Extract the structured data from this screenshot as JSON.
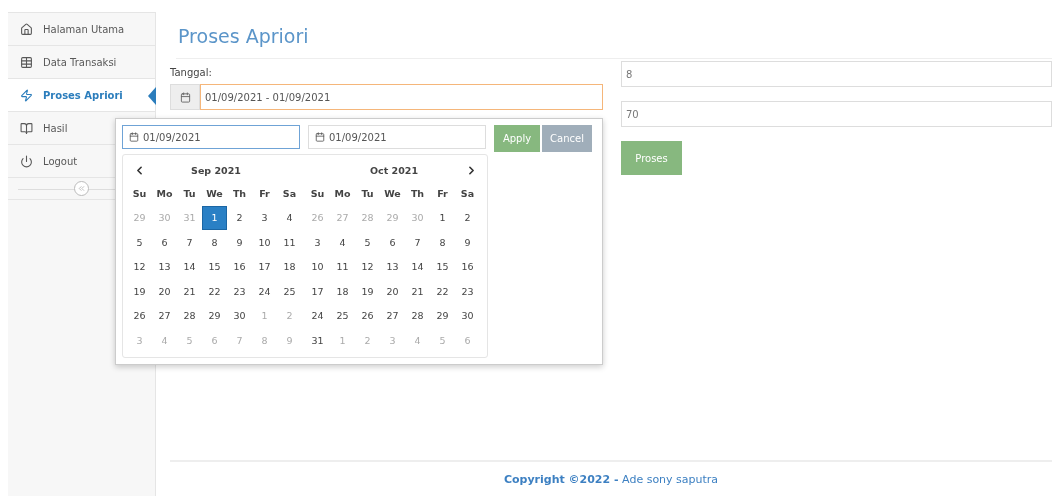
{
  "sidebar": {
    "items": [
      {
        "label": "Halaman Utama",
        "selected": false
      },
      {
        "label": "Data Transaksi",
        "selected": false
      },
      {
        "label": "Proses Apriori",
        "selected": true
      },
      {
        "label": "Hasil",
        "selected": false
      },
      {
        "label": "Logout",
        "selected": false
      }
    ]
  },
  "page": {
    "title": "Proses Apriori"
  },
  "form": {
    "date_label": "Tanggal:",
    "date_value": "01/09/2021 - 01/09/2021",
    "field_1": "8",
    "field_2": "70",
    "submit": "Proses"
  },
  "datepicker": {
    "start": "01/09/2021",
    "end": "01/09/2021",
    "apply": "Apply",
    "cancel": "Cancel",
    "months": [
      {
        "title": "Sep 2021",
        "weekdays": [
          "Su",
          "Mo",
          "Tu",
          "We",
          "Th",
          "Fr",
          "Sa"
        ],
        "weeks": [
          [
            {
              "d": "29",
              "off": true,
              "selected": false
            },
            {
              "d": "30",
              "off": true,
              "selected": false
            },
            {
              "d": "31",
              "off": true,
              "selected": false
            },
            {
              "d": "1",
              "off": false,
              "selected": true
            },
            {
              "d": "2",
              "off": false,
              "selected": false
            },
            {
              "d": "3",
              "off": false,
              "selected": false
            },
            {
              "d": "4",
              "off": false,
              "selected": false
            }
          ],
          [
            {
              "d": "5",
              "off": false,
              "selected": false
            },
            {
              "d": "6",
              "off": false,
              "selected": false
            },
            {
              "d": "7",
              "off": false,
              "selected": false
            },
            {
              "d": "8",
              "off": false,
              "selected": false
            },
            {
              "d": "9",
              "off": false,
              "selected": false
            },
            {
              "d": "10",
              "off": false,
              "selected": false
            },
            {
              "d": "11",
              "off": false,
              "selected": false
            }
          ],
          [
            {
              "d": "12",
              "off": false,
              "selected": false
            },
            {
              "d": "13",
              "off": false,
              "selected": false
            },
            {
              "d": "14",
              "off": false,
              "selected": false
            },
            {
              "d": "15",
              "off": false,
              "selected": false
            },
            {
              "d": "16",
              "off": false,
              "selected": false
            },
            {
              "d": "17",
              "off": false,
              "selected": false
            },
            {
              "d": "18",
              "off": false,
              "selected": false
            }
          ],
          [
            {
              "d": "19",
              "off": false,
              "selected": false
            },
            {
              "d": "20",
              "off": false,
              "selected": false
            },
            {
              "d": "21",
              "off": false,
              "selected": false
            },
            {
              "d": "22",
              "off": false,
              "selected": false
            },
            {
              "d": "23",
              "off": false,
              "selected": false
            },
            {
              "d": "24",
              "off": false,
              "selected": false
            },
            {
              "d": "25",
              "off": false,
              "selected": false
            }
          ],
          [
            {
              "d": "26",
              "off": false,
              "selected": false
            },
            {
              "d": "27",
              "off": false,
              "selected": false
            },
            {
              "d": "28",
              "off": false,
              "selected": false
            },
            {
              "d": "29",
              "off": false,
              "selected": false
            },
            {
              "d": "30",
              "off": false,
              "selected": false
            },
            {
              "d": "1",
              "off": true,
              "selected": false
            },
            {
              "d": "2",
              "off": true,
              "selected": false
            }
          ],
          [
            {
              "d": "3",
              "off": true,
              "selected": false
            },
            {
              "d": "4",
              "off": true,
              "selected": false
            },
            {
              "d": "5",
              "off": true,
              "selected": false
            },
            {
              "d": "6",
              "off": true,
              "selected": false
            },
            {
              "d": "7",
              "off": true,
              "selected": false
            },
            {
              "d": "8",
              "off": true,
              "selected": false
            },
            {
              "d": "9",
              "off": true,
              "selected": false
            }
          ]
        ]
      },
      {
        "title": "Oct 2021",
        "weekdays": [
          "Su",
          "Mo",
          "Tu",
          "We",
          "Th",
          "Fr",
          "Sa"
        ],
        "weeks": [
          [
            {
              "d": "26",
              "off": true,
              "selected": false
            },
            {
              "d": "27",
              "off": true,
              "selected": false
            },
            {
              "d": "28",
              "off": true,
              "selected": false
            },
            {
              "d": "29",
              "off": true,
              "selected": false
            },
            {
              "d": "30",
              "off": true,
              "selected": false
            },
            {
              "d": "1",
              "off": false,
              "selected": false
            },
            {
              "d": "2",
              "off": false,
              "selected": false
            }
          ],
          [
            {
              "d": "3",
              "off": false,
              "selected": false
            },
            {
              "d": "4",
              "off": false,
              "selected": false
            },
            {
              "d": "5",
              "off": false,
              "selected": false
            },
            {
              "d": "6",
              "off": false,
              "selected": false
            },
            {
              "d": "7",
              "off": false,
              "selected": false
            },
            {
              "d": "8",
              "off": false,
              "selected": false
            },
            {
              "d": "9",
              "off": false,
              "selected": false
            }
          ],
          [
            {
              "d": "10",
              "off": false,
              "selected": false
            },
            {
              "d": "11",
              "off": false,
              "selected": false
            },
            {
              "d": "12",
              "off": false,
              "selected": false
            },
            {
              "d": "13",
              "off": false,
              "selected": false
            },
            {
              "d": "14",
              "off": false,
              "selected": false
            },
            {
              "d": "15",
              "off": false,
              "selected": false
            },
            {
              "d": "16",
              "off": false,
              "selected": false
            }
          ],
          [
            {
              "d": "17",
              "off": false,
              "selected": false
            },
            {
              "d": "18",
              "off": false,
              "selected": false
            },
            {
              "d": "19",
              "off": false,
              "selected": false
            },
            {
              "d": "20",
              "off": false,
              "selected": false
            },
            {
              "d": "21",
              "off": false,
              "selected": false
            },
            {
              "d": "22",
              "off": false,
              "selected": false
            },
            {
              "d": "23",
              "off": false,
              "selected": false
            }
          ],
          [
            {
              "d": "24",
              "off": false,
              "selected": false
            },
            {
              "d": "25",
              "off": false,
              "selected": false
            },
            {
              "d": "26",
              "off": false,
              "selected": false
            },
            {
              "d": "27",
              "off": false,
              "selected": false
            },
            {
              "d": "28",
              "off": false,
              "selected": false
            },
            {
              "d": "29",
              "off": false,
              "selected": false
            },
            {
              "d": "30",
              "off": false,
              "selected": false
            }
          ],
          [
            {
              "d": "31",
              "off": false,
              "selected": false
            },
            {
              "d": "1",
              "off": true,
              "selected": false
            },
            {
              "d": "2",
              "off": true,
              "selected": false
            },
            {
              "d": "3",
              "off": true,
              "selected": false
            },
            {
              "d": "4",
              "off": true,
              "selected": false
            },
            {
              "d": "5",
              "off": true,
              "selected": false
            },
            {
              "d": "6",
              "off": true,
              "selected": false
            }
          ]
        ]
      }
    ]
  },
  "footer": {
    "text": "**Copyright ©2022 -** Ade sony saputra"
  }
}
